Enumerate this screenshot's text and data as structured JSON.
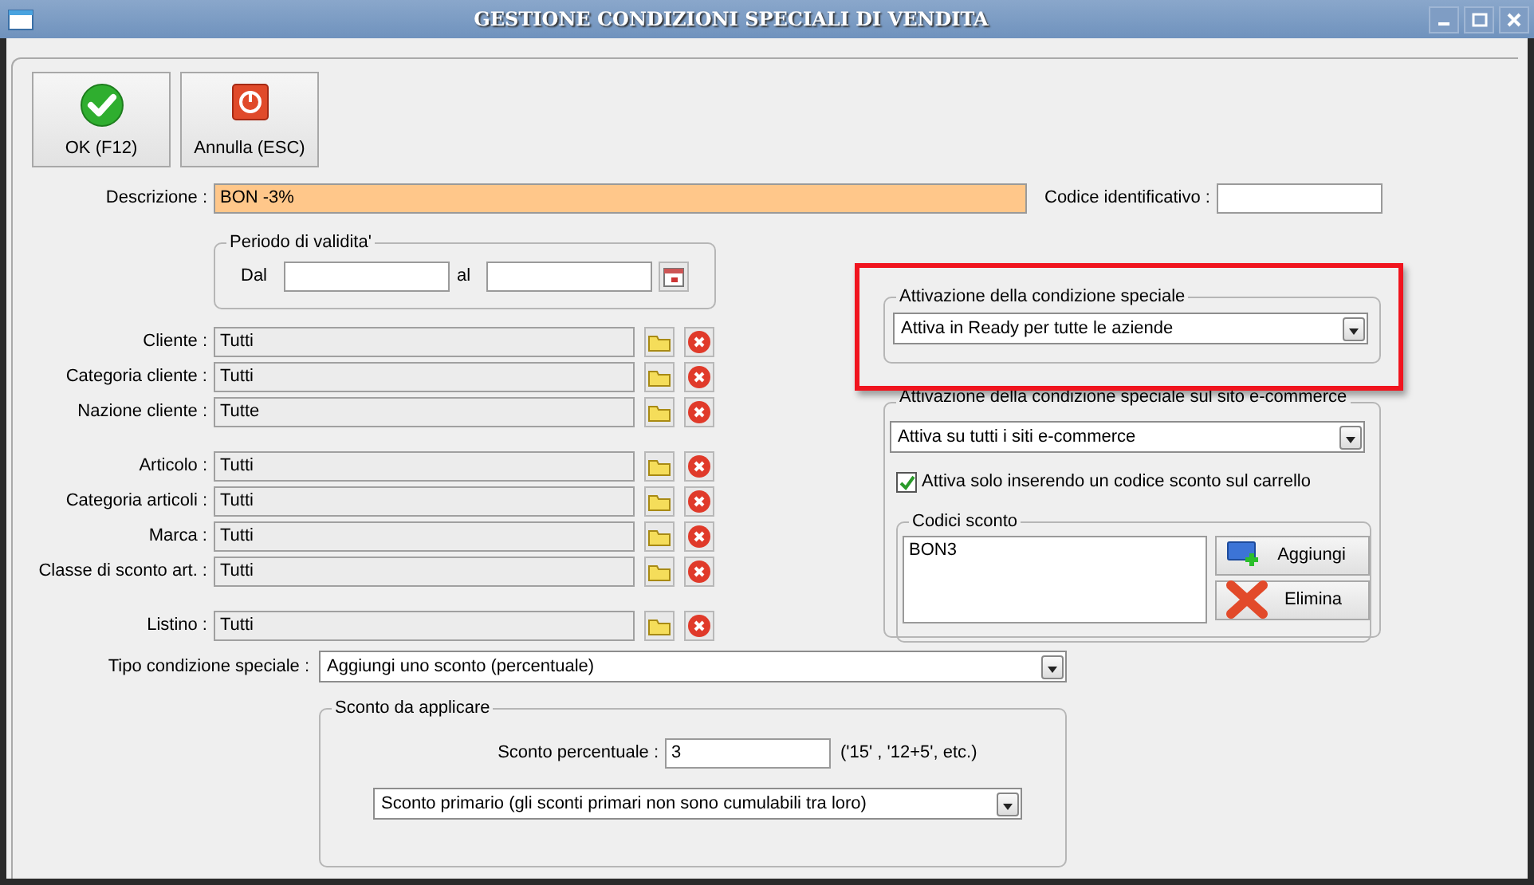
{
  "window": {
    "title": "GESTIONE CONDIZIONI SPECIALI DI VENDITA"
  },
  "toolbar": [
    {
      "label": "OK (F12)",
      "kind": "ok"
    },
    {
      "label": "Annulla (ESC)",
      "kind": "cancel"
    }
  ],
  "descrizione": {
    "label": "Descrizione :",
    "value": "BON -3%"
  },
  "codice_identificativo": {
    "label": "Codice identificativo :"
  },
  "periodo": {
    "legend": "Periodo di validita'",
    "from_label": "Dal",
    "to_label": "al"
  },
  "filter_groups": [
    [
      {
        "label": "Cliente :",
        "value": "Tutti"
      },
      {
        "label": "Categoria cliente :",
        "value": "Tutti"
      },
      {
        "label": "Nazione cliente :",
        "value": "Tutte"
      }
    ],
    [
      {
        "label": "Articolo :",
        "value": "Tutti"
      },
      {
        "label": "Categoria articoli :",
        "value": "Tutti"
      },
      {
        "label": "Marca :",
        "value": "Tutti"
      },
      {
        "label": "Classe di sconto art. :",
        "value": "Tutti"
      }
    ],
    [
      {
        "label": "Listino :",
        "value": "Tutti"
      }
    ]
  ],
  "attivazione": {
    "legend": "Attivazione della condizione speciale",
    "value": "Attiva in Ready per tutte le aziende",
    "highlighted": true
  },
  "ecommerce": {
    "legend": "Attivazione della condizione speciale sul sito e-commerce",
    "value": "Attiva su tutti i siti e-commerce",
    "checkbox": {
      "label": "Attiva solo inserendo un codice sconto sul carrello",
      "checked": true
    },
    "codici": {
      "legend": "Codici sconto",
      "items": [
        "BON3"
      ],
      "buttons": [
        {
          "label": "Aggiungi",
          "kind": "add"
        },
        {
          "label": "Elimina",
          "kind": "delete"
        }
      ]
    }
  },
  "tipo": {
    "label": "Tipo condizione speciale :",
    "value": "Aggiungi uno sconto (percentuale)"
  },
  "sconto": {
    "legend": "Sconto da applicare",
    "label": "Sconto percentuale :",
    "value": "3",
    "hint": "('15' , '12+5', etc.)",
    "type_value": "Sconto primario (gli sconti primari non sono cumulabili tra loro)"
  }
}
